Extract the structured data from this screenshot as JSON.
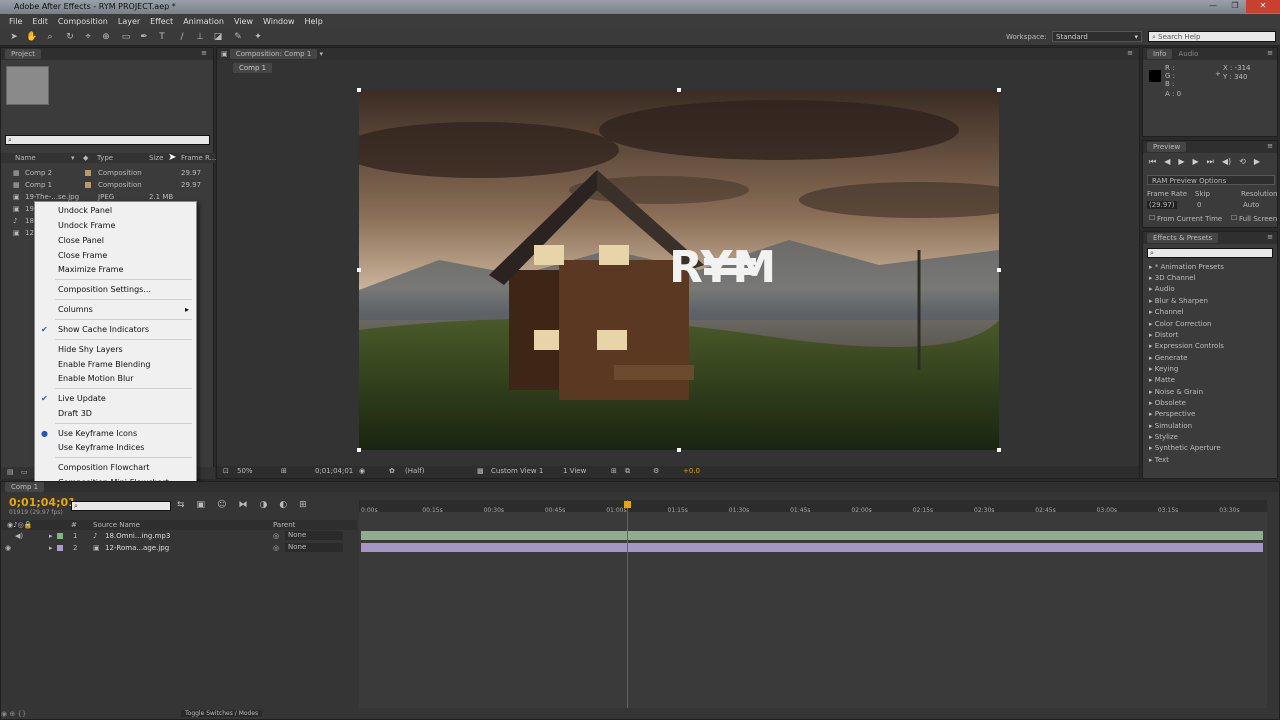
{
  "app": {
    "title": "Adobe After Effects - RYM PROJECT.aep *"
  },
  "menu": [
    "File",
    "Edit",
    "Composition",
    "Layer",
    "Effect",
    "Animation",
    "View",
    "Window",
    "Help"
  ],
  "window_buttons": {
    "minimize": "—",
    "maximize": "❐",
    "close": "✕"
  },
  "toolbar": {
    "workspace_label": "Workspace:",
    "workspace_value": "Standard",
    "search_help": "Search Help"
  },
  "project": {
    "tab": "Project",
    "search_placeholder": "",
    "columns": {
      "name": "Name",
      "type": "Type",
      "size": "Size",
      "frame_rate": "Frame R..."
    },
    "items": [
      {
        "name": "Comp 2",
        "type": "Composition",
        "size": "",
        "fps": "29.97"
      },
      {
        "name": "Comp 1",
        "type": "Composition",
        "size": "",
        "fps": "29.97"
      },
      {
        "name": "19-The-...se.jpg",
        "type": "JPEG",
        "size": "2.1 MB",
        "fps": ""
      },
      {
        "name": "19...",
        "type": "",
        "size": "",
        "fps": ""
      },
      {
        "name": "18...",
        "type": "",
        "size": "",
        "fps": ""
      },
      {
        "name": "12-...",
        "type": "",
        "size": "",
        "fps": ""
      }
    ]
  },
  "context_menu": [
    {
      "label": "Undock Panel"
    },
    {
      "label": "Undock Frame"
    },
    {
      "label": "Close Panel"
    },
    {
      "label": "Close Frame"
    },
    {
      "label": "Maximize Frame"
    },
    {
      "label": "Composition Settings..."
    },
    {
      "label": "Columns"
    },
    {
      "label": "Show Cache Indicators"
    },
    {
      "label": "Hide Shy Layers"
    },
    {
      "label": "Enable Frame Blending"
    },
    {
      "label": "Enable Motion Blur"
    },
    {
      "label": "Live Update"
    },
    {
      "label": "Draft 3D"
    },
    {
      "label": "Use Keyframe Icons"
    },
    {
      "label": "Use Keyframe Indices"
    },
    {
      "label": "Composition Flowchart"
    },
    {
      "label": "Composition Mini-Flowchart"
    }
  ],
  "context_marks": {
    "check": "✔",
    "bullet": "●",
    "submenu": "▸"
  },
  "comp_viewer": {
    "tab": "Composition: Comp 1",
    "breadcrumb": "Comp 1",
    "zoom": "50%",
    "timecode": "0;01;04;01",
    "resolution": "(Half)",
    "view": "Custom View 1",
    "views": "1 View",
    "exposure": "+0.0",
    "logo_text": "RYM"
  },
  "info": {
    "tab_info": "Info",
    "tab_audio": "Audio",
    "r": "R :",
    "g": "G :",
    "b": "B :",
    "a": "A : 0",
    "x": "X : -314",
    "y": "Y : 340"
  },
  "preview": {
    "tab": "Preview",
    "ram_options": "RAM Preview Options",
    "frame_rate_label": "Frame Rate",
    "skip_label": "Skip",
    "resolution_label": "Resolution",
    "frame_rate": "(29.97)",
    "skip": "0",
    "resolution": "Auto",
    "from_current": "From Current Time",
    "full_screen": "Full Screen"
  },
  "effects": {
    "tab": "Effects & Presets",
    "items": [
      "* Animation Presets",
      "3D Channel",
      "Audio",
      "Blur & Sharpen",
      "Channel",
      "Color Correction",
      "Distort",
      "Expression Controls",
      "Generate",
      "Keying",
      "Matte",
      "Noise & Grain",
      "Obsolete",
      "Perspective",
      "Simulation",
      "Stylize",
      "Synthetic Aperture",
      "Text"
    ]
  },
  "timeline": {
    "tab": "Comp 1",
    "timecode": "0;01;04;01",
    "frame_info": "01919 (29.97 fps)",
    "col_source": "Source Name",
    "col_parent": "Parent",
    "toggle": "Toggle Switches / Modes",
    "ruler": [
      "0:00s",
      "00:15s",
      "00:30s",
      "00:45s",
      "01:00s",
      "01:15s",
      "01:30s",
      "01:45s",
      "02:00s",
      "02:15s",
      "02:30s",
      "02:45s",
      "03:00s",
      "03:15s",
      "03:30s"
    ],
    "layers": [
      {
        "num": "1",
        "name": "18.Omni...ing.mp3",
        "parent": "None"
      },
      {
        "num": "2",
        "name": "12-Roma...age.jpg",
        "parent": "None"
      }
    ],
    "playhead_fraction": 0.295
  }
}
